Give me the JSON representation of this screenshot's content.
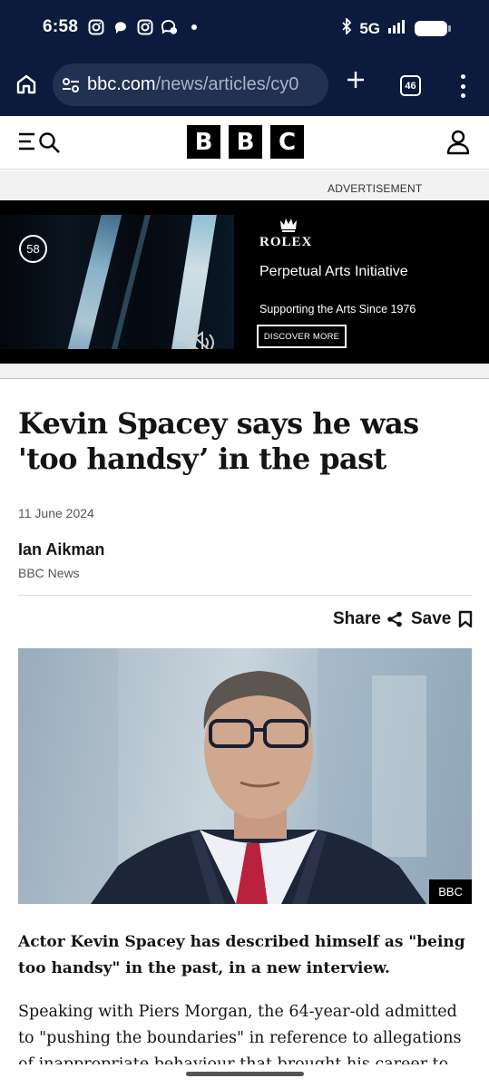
{
  "status_bar": {
    "time": "6:58",
    "network": "5G",
    "icons": [
      "instagram-icon",
      "threads-icon",
      "instagram-icon",
      "messenger-icon",
      "dot-icon",
      "bluetooth-icon",
      "signal-icon",
      "battery-icon"
    ]
  },
  "browser": {
    "url_domain": "bbc.com",
    "url_path": "/news/articles/cy0",
    "tab_count": "46"
  },
  "bbc_header": {
    "logo_letters": [
      "B",
      "B",
      "C"
    ]
  },
  "ad": {
    "label": "ADVERTISEMENT",
    "countdown": "58",
    "brand": "ROLEX",
    "title": "Perpetual Arts Initiative",
    "subtitle": "Supporting the Arts Since 1976",
    "cta": "DISCOVER MORE"
  },
  "article": {
    "headline": "Kevin Spacey says he was 'too handsy’ in the past",
    "date": "11 June 2024",
    "author": "Ian Aikman",
    "source": "BBC News",
    "share_label": "Share",
    "save_label": "Save",
    "image_credit": "BBC",
    "lead": "Actor Kevin Spacey has described himself as \"being too handsy\" in the past, in a new interview.",
    "body_paragraph": "Speaking with Piers Morgan, the 64-year-old admitted to \"pushing the boundaries\" in reference to allegations of inappropriate behaviour that brought his career to"
  },
  "colors": {
    "chrome_bg": "#0c1a3d",
    "url_box_bg": "#223052",
    "text_primary": "#141414",
    "text_secondary": "#545658"
  }
}
